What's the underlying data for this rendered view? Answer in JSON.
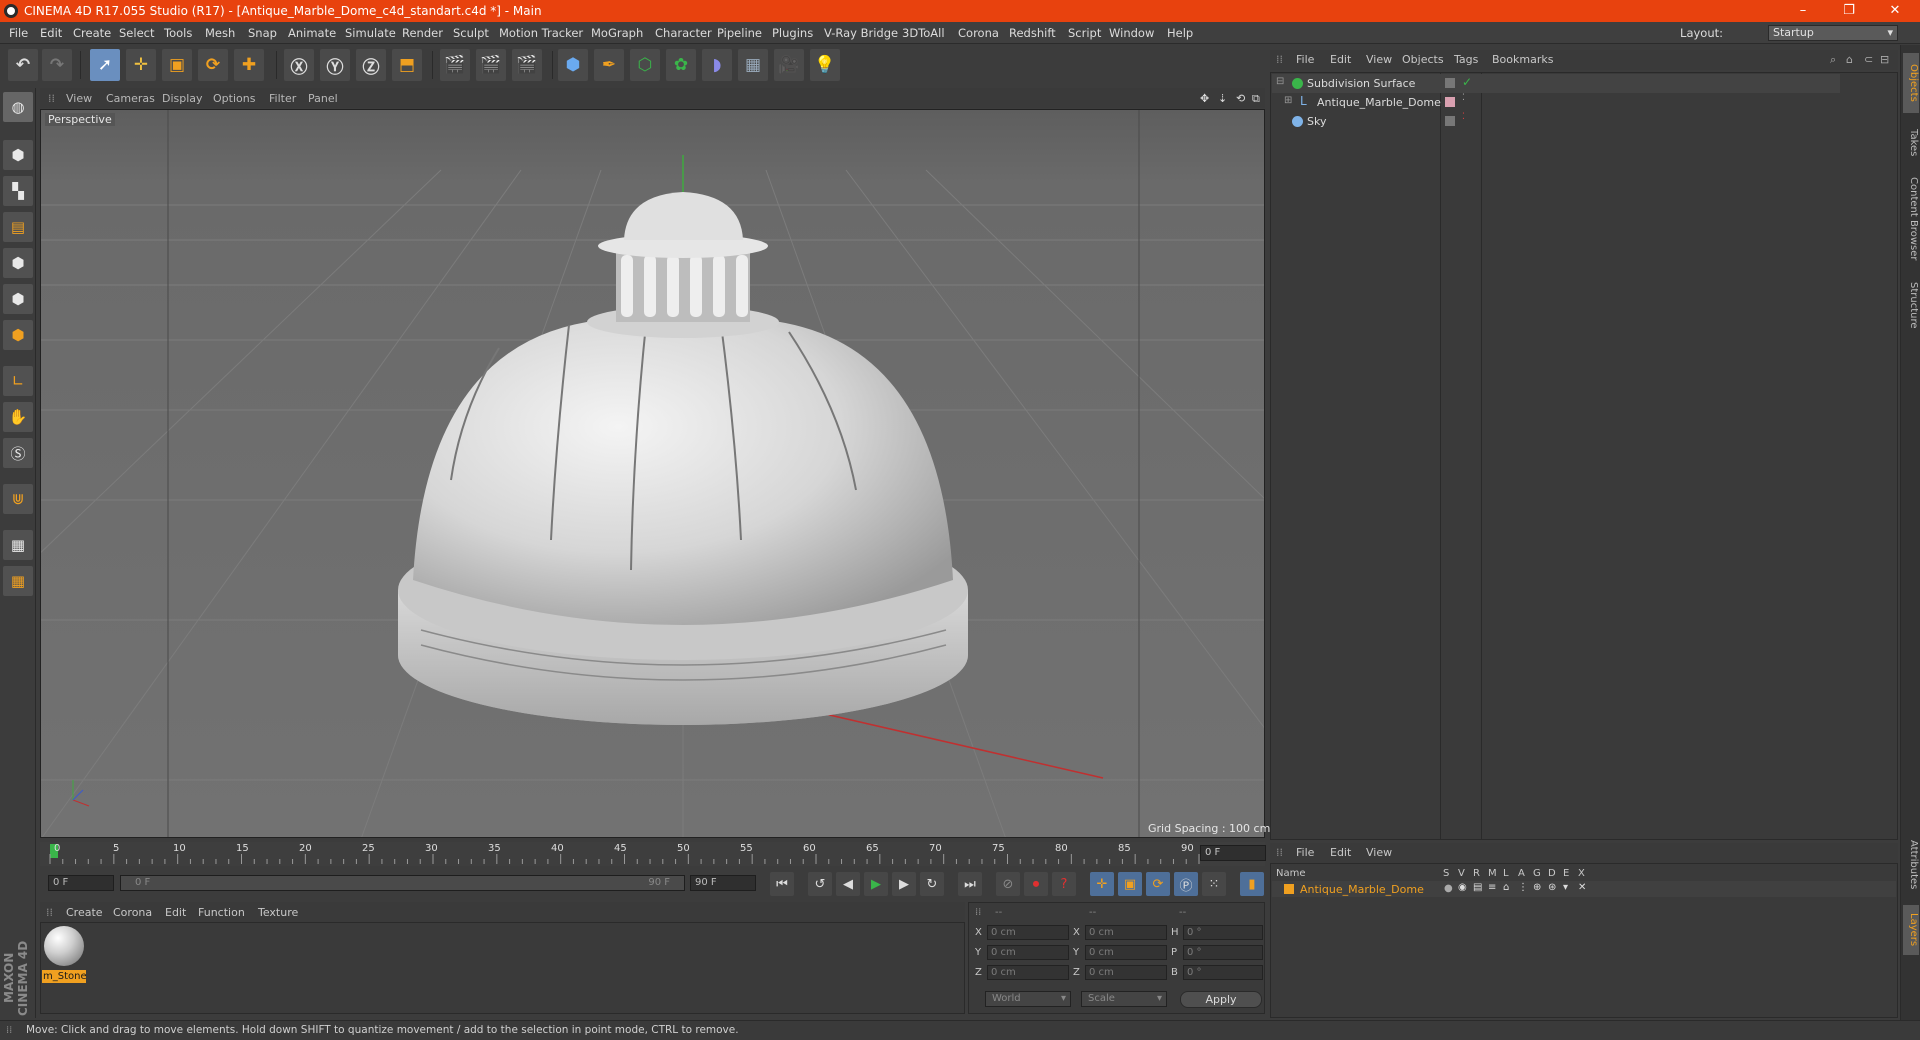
{
  "window": {
    "title": "CINEMA 4D R17.055 Studio (R17) - [Antique_Marble_Dome_c4d_standart.c4d *] - Main",
    "buttons": [
      "–",
      "❐",
      "✕"
    ]
  },
  "menubar": {
    "items": [
      "File",
      "Edit",
      "Create",
      "Select",
      "Tools",
      "Mesh",
      "Snap",
      "Animate",
      "Simulate",
      "Render",
      "Sculpt",
      "Motion Tracker",
      "MoGraph",
      "Character",
      "Pipeline",
      "Plugins",
      "V-Ray Bridge",
      "3DToAll",
      "Corona",
      "Redshift",
      "Script",
      "Window",
      "Help"
    ],
    "layout_label": "Layout:",
    "layout_value": "Startup"
  },
  "viewport": {
    "menu": [
      "View",
      "Cameras",
      "Display",
      "Options",
      "Filter",
      "Panel"
    ],
    "label": "Perspective",
    "grid_spacing": "Grid Spacing : 100 cm"
  },
  "timeline": {
    "ticks": [
      "0",
      "5",
      "10",
      "15",
      "20",
      "25",
      "30",
      "35",
      "40",
      "45",
      "50",
      "55",
      "60",
      "65",
      "70",
      "75",
      "80",
      "85",
      "90"
    ],
    "current_frame": "0 F",
    "start_field": "0 F",
    "range_start": "0 F",
    "range_end": "90 F",
    "end_field": "90 F"
  },
  "materials": {
    "menu": [
      "Create",
      "Corona",
      "Edit",
      "Function",
      "Texture"
    ],
    "items": [
      {
        "name": "m_Stone"
      }
    ]
  },
  "coordinates": {
    "headers": [
      "--",
      "--",
      "--"
    ],
    "rows": [
      {
        "axis": "X",
        "pos": "0 cm",
        "axis2": "X",
        "size": "0 cm",
        "rot_label": "H",
        "rot": "0 °"
      },
      {
        "axis": "Y",
        "pos": "0 cm",
        "axis2": "Y",
        "size": "0 cm",
        "rot_label": "P",
        "rot": "0 °"
      },
      {
        "axis": "Z",
        "pos": "0 cm",
        "axis2": "Z",
        "size": "0 cm",
        "rot_label": "B",
        "rot": "0 °"
      }
    ],
    "space": "World",
    "mode": "Scale",
    "apply": "Apply"
  },
  "object_manager": {
    "menu": [
      "File",
      "Edit",
      "View",
      "Objects",
      "Tags",
      "Bookmarks"
    ],
    "objects": [
      {
        "name": "Subdivision Surface",
        "icon_color": "#3ab54a"
      },
      {
        "name": "Antique_Marble_Dome",
        "icon_color": "#7fb3e8"
      },
      {
        "name": "Sky",
        "icon_color": "#7fb3e8"
      }
    ]
  },
  "layer_manager": {
    "menu": [
      "File",
      "Edit",
      "View"
    ],
    "columns": [
      "Name",
      "S",
      "V",
      "R",
      "M",
      "L",
      "A",
      "G",
      "D",
      "E",
      "X"
    ],
    "layers": [
      {
        "name": "Antique_Marble_Dome",
        "color": "#f0a020"
      }
    ]
  },
  "side_tabs": [
    "Objects",
    "Takes",
    "Content Browser",
    "Structure",
    "Attributes",
    "Layers"
  ],
  "status": "Move: Click and drag to move elements. Hold down SHIFT to quantize movement / add to the selection in point mode, CTRL to remove.",
  "logo": "MAXON CINEMA 4D",
  "colors": {
    "title_bar": "#e8420e",
    "accent_orange": "#f0a020",
    "viewport_bg": "#6c6c6c"
  }
}
